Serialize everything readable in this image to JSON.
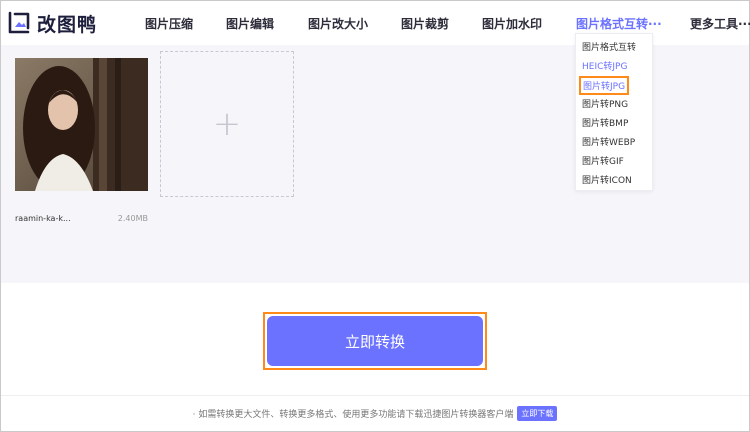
{
  "app": {
    "name": "改图鸭",
    "accent_color": "#6b72ff",
    "highlight_color": "#ff8a1a"
  },
  "nav": {
    "items": [
      {
        "label": "图片压缩"
      },
      {
        "label": "图片编辑"
      },
      {
        "label": "图片改大小"
      },
      {
        "label": "图片裁剪"
      },
      {
        "label": "图片加水印"
      },
      {
        "label": "图片格式互转···",
        "active": true
      },
      {
        "label": "更多工具···"
      }
    ]
  },
  "dropdown": {
    "items": [
      {
        "label": "图片格式互转"
      },
      {
        "label": "HEIC转JPG",
        "style": "blue"
      },
      {
        "label": "图片转JPG",
        "style": "highlighted"
      },
      {
        "label": "图片转PNG"
      },
      {
        "label": "图片转BMP"
      },
      {
        "label": "图片转WEBP"
      },
      {
        "label": "图片转GIF"
      },
      {
        "label": "图片转ICON"
      }
    ]
  },
  "upload": {
    "file": {
      "name": "raamin-ka-k...",
      "size": "2.40MB"
    },
    "add_icon": "plus-icon",
    "add_symbol": "+"
  },
  "actions": {
    "convert_label": "立即转换"
  },
  "footer": {
    "notice": "· 如需转换更大文件、转换更多格式、使用更多功能请下载迅捷图片转换器客户端",
    "download_label": "立即下载"
  }
}
